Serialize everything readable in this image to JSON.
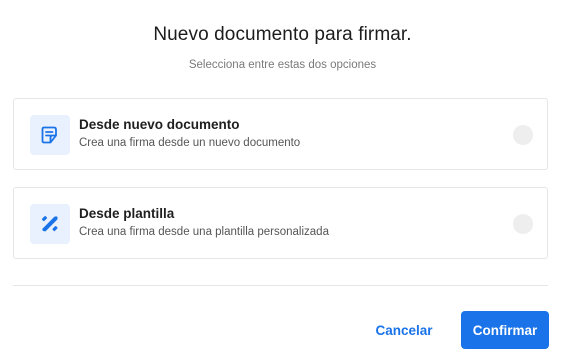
{
  "dialog": {
    "title": "Nuevo documento para firmar.",
    "subtitle": "Selecciona entre estas dos opciones"
  },
  "options": [
    {
      "title": "Desde nuevo documento",
      "description": "Crea una firma desde un nuevo documento",
      "icon": "document-edit-icon",
      "selected": false
    },
    {
      "title": "Desde plantilla",
      "description": "Crea una firma desde una plantilla personalizada",
      "icon": "template-tools-icon",
      "selected": false
    }
  ],
  "actions": {
    "cancel_label": "Cancelar",
    "confirm_label": "Confirmar"
  },
  "colors": {
    "accent": "#1a73e8",
    "icon_bg": "#e8f1fd",
    "radio_bg": "#eeeeee",
    "border": "#e6e6e6"
  }
}
